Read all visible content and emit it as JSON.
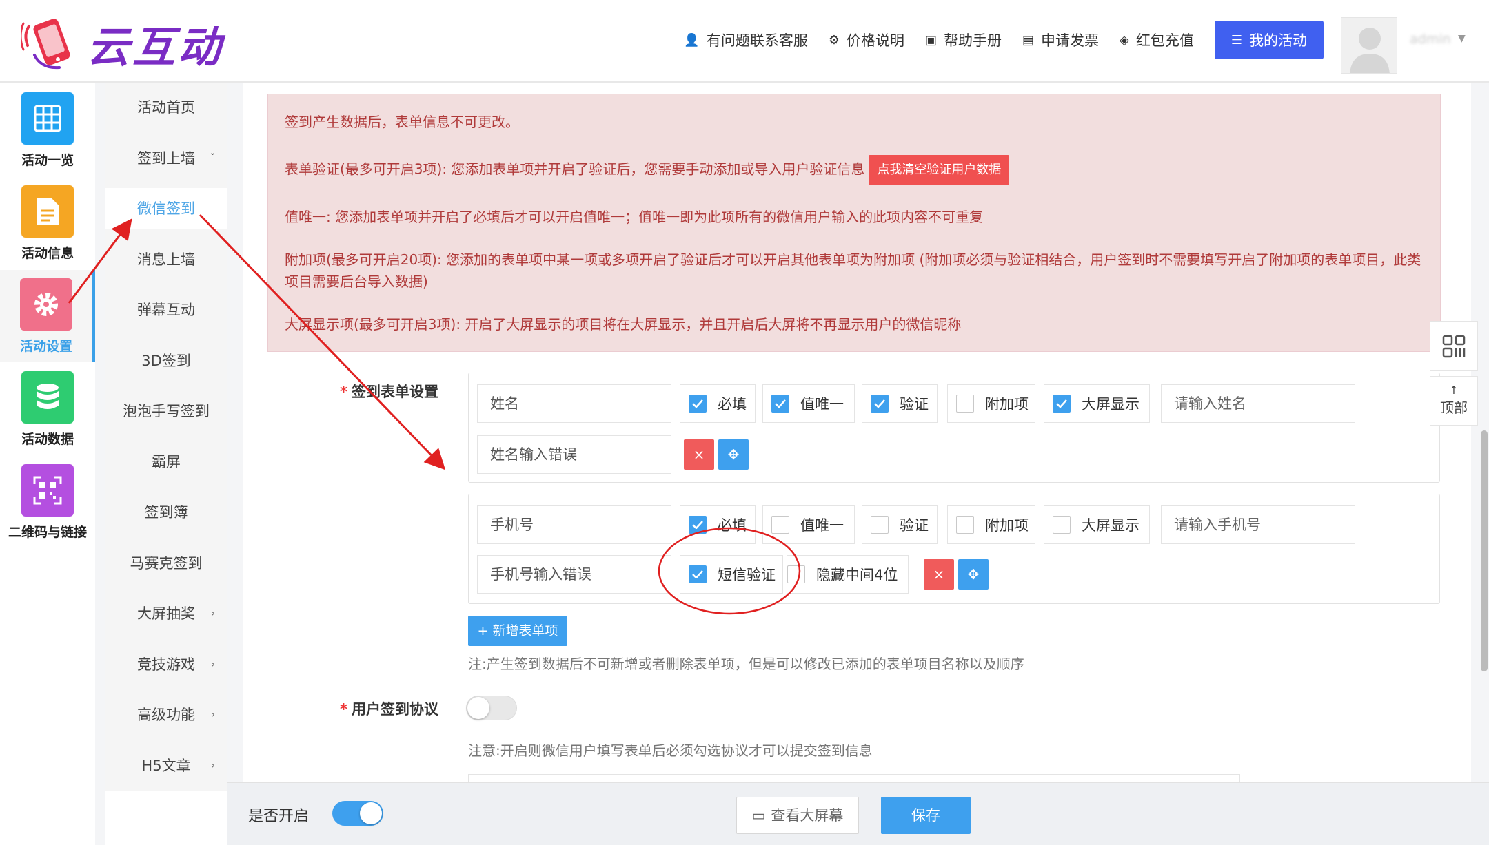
{
  "header": {
    "logo_text": "云互动",
    "nav": [
      {
        "label": "有问题联系客服",
        "icon": "user-add-icon",
        "glyph": "👤"
      },
      {
        "label": "价格说明",
        "icon": "gear-icon",
        "glyph": "⚙"
      },
      {
        "label": "帮助手册",
        "icon": "book-icon",
        "glyph": "▣"
      },
      {
        "label": "申请发票",
        "icon": "printer-icon",
        "glyph": "▤"
      },
      {
        "label": "红包充值",
        "icon": "shield-check-icon",
        "glyph": "◈"
      }
    ],
    "my_activity": "我的活动",
    "my_activity_icon": "list-icon",
    "username": "admin",
    "brand_color": "#4060f0"
  },
  "icon_nav": [
    {
      "label": "活动一览",
      "icon": "grid-icon",
      "color": "#21a3f1"
    },
    {
      "label": "活动信息",
      "icon": "document-icon",
      "color": "#f5a623"
    },
    {
      "label": "活动设置",
      "icon": "settings-icon",
      "color": "#f0708a",
      "active": true
    },
    {
      "label": "活动数据",
      "icon": "database-icon",
      "color": "#2ecc71"
    },
    {
      "label": "二维码与链接",
      "icon": "qrcode-icon",
      "color": "#b44fe0"
    }
  ],
  "sub_nav": [
    {
      "label": "活动首页"
    },
    {
      "label": "签到上墙",
      "arrow": "ˇ"
    },
    {
      "label": "微信签到",
      "active": true
    },
    {
      "label": "消息上墙"
    },
    {
      "label": "弹幕互动"
    },
    {
      "label": "3D签到"
    },
    {
      "label": "泡泡手写签到"
    },
    {
      "label": "霸屏"
    },
    {
      "label": "签到簿"
    },
    {
      "label": "马赛克签到"
    },
    {
      "label": "大屏抽奖",
      "arrow": "›"
    },
    {
      "label": "竞技游戏",
      "arrow": "›"
    },
    {
      "label": "高级功能",
      "arrow": "›"
    },
    {
      "label": "H5文章",
      "arrow": "›"
    }
  ],
  "notice": {
    "line1": "签到产生数据后，表单信息不可更改。",
    "line2": "表单验证(最多可开启3项): 您添加表单项并开启了验证后，您需要手动添加或导入用户验证信息",
    "clear_btn": "点我清空验证用户数据",
    "line3": "值唯一: 您添加表单项并开启了必填后才可以开启值唯一；值唯一即为此项所有的微信用户输入的此项内容不可重复",
    "line4": "附加项(最多可开启20项): 您添加的表单项中某一项或多项开启了验证后才可以开启其他表单项为附加项 (附加项必须与验证相结合，用户签到时不需要填写开启了附加项的表单项目，此类项目需要后台导入数据)",
    "line5": "大屏显示项(最多可开启3项): 开启了大屏显示的项目将在大屏显示，并且开启后大屏将不再显示用户的微信昵称"
  },
  "form": {
    "section_label": "签到表单设置",
    "fields": [
      {
        "name": "姓名",
        "error": "姓名输入错误",
        "placeholder": "请输入姓名",
        "options": [
          {
            "label": "必填",
            "checked": true
          },
          {
            "label": "值唯一",
            "checked": true
          },
          {
            "label": "验证",
            "checked": true
          },
          {
            "label": "附加项",
            "checked": false
          },
          {
            "label": "大屏显示",
            "checked": true
          }
        ]
      },
      {
        "name": "手机号",
        "error": "手机号输入错误",
        "placeholder": "请输入手机号",
        "options": [
          {
            "label": "必填",
            "checked": true
          },
          {
            "label": "值唯一",
            "checked": false
          },
          {
            "label": "验证",
            "checked": false
          },
          {
            "label": "附加项",
            "checked": false
          },
          {
            "label": "大屏显示",
            "checked": false
          }
        ],
        "extra": [
          {
            "label": "短信验证",
            "checked": true
          },
          {
            "label": "隐藏中间4位",
            "checked": false
          }
        ]
      }
    ],
    "add_btn": "+ 新增表单项",
    "note1": "注:产生签到数据后不可新增或者删除表单项，但是可以修改已添加的表单项目名称以及顺序",
    "agreement_label": "用户签到协议",
    "agreement_on": false,
    "note2": "注意:开启则微信用户填写表单后必须勾选协议才可以提交签到信息"
  },
  "float_tools": {
    "top_label": "顶部",
    "top_arrow": "↑"
  },
  "bottom": {
    "enable_label": "是否开启",
    "enabled": true,
    "view_btn": "查看大屏幕",
    "save_btn": "保存"
  },
  "accent_color": "#3ea0ee"
}
